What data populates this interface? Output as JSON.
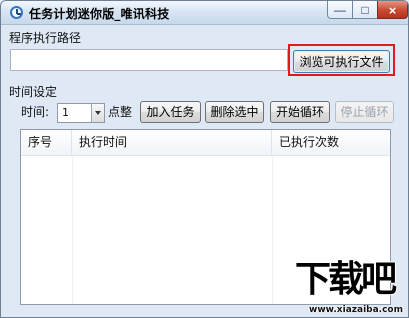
{
  "window": {
    "title": "任务计划迷你版_唯讯科技",
    "controls": {
      "minimize": "—",
      "maximize": "□",
      "close": "×"
    }
  },
  "program_path": {
    "label": "程序执行路径",
    "value": "",
    "browse_label": "浏览可执行文件"
  },
  "time_settings": {
    "label": "时间设定",
    "hour_label": "时间:",
    "hour_value": "1",
    "hour_suffix": "点整",
    "buttons": {
      "add_task": "加入任务",
      "delete_selected": "删除选中",
      "start_loop": "开始循环",
      "stop_loop": "停止循环"
    }
  },
  "task_table": {
    "columns": [
      "序号",
      "执行时间",
      "已执行次数"
    ],
    "rows": []
  },
  "watermark": {
    "main": "下载吧",
    "url": "www.xiazaiba.com"
  },
  "colors": {
    "window_background": "#dfe9f5",
    "highlight": "#e11b1b",
    "browse_button_border": "#3c7fb1"
  },
  "icons": {
    "app": "clock-icon",
    "dropdown": "chevron-down-icon"
  }
}
